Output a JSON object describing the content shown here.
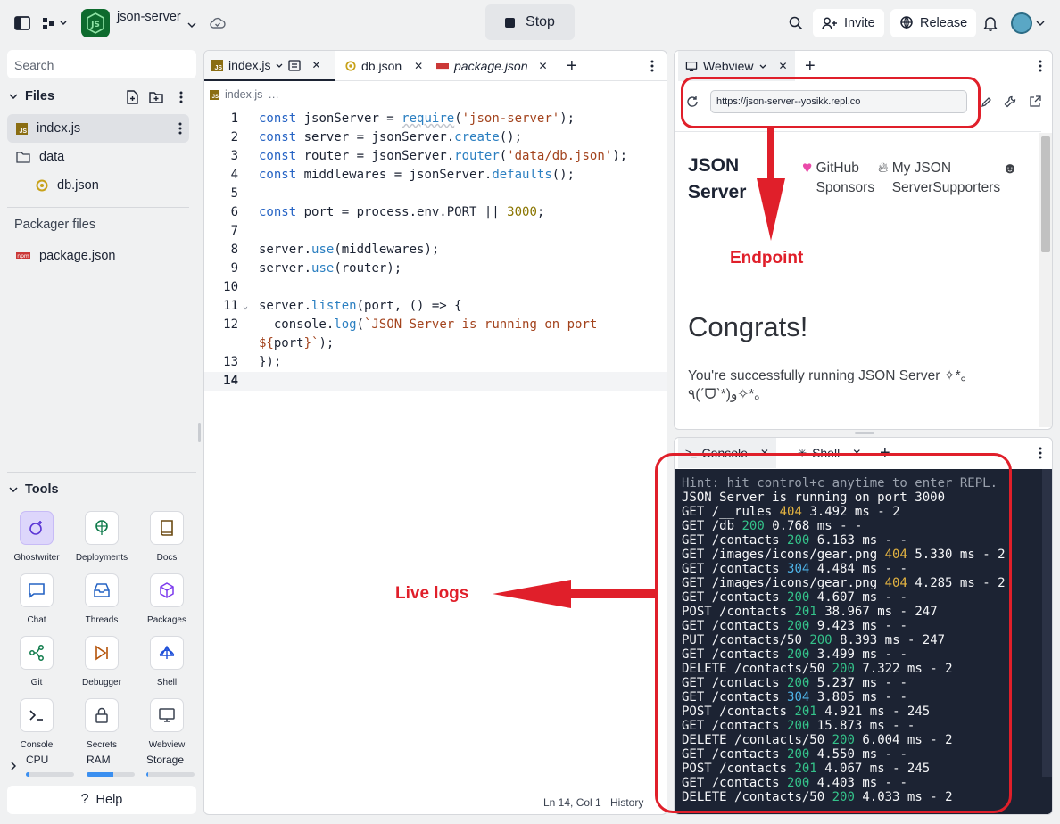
{
  "app": {
    "name": "json-server",
    "stop_label": "Stop",
    "invite_label": "Invite",
    "release_label": "Release"
  },
  "sidebar": {
    "search_placeholder": "Search",
    "files_heading": "Files",
    "files": [
      {
        "name": "index.js",
        "icon": "js-file-icon"
      },
      {
        "name": "data",
        "icon": "folder-icon"
      },
      {
        "name": "db.json",
        "icon": "json-file-icon"
      }
    ],
    "packager_heading": "Packager files",
    "packager_files": [
      {
        "name": "package.json",
        "icon": "npm-icon"
      }
    ],
    "tools_heading": "Tools",
    "tools": [
      "Ghostwriter",
      "Deployments",
      "Docs",
      "Chat",
      "Threads",
      "Packages",
      "Git",
      "Debugger",
      "Shell",
      "Console",
      "Secrets",
      "Webview"
    ],
    "resources": [
      {
        "label": "CPU",
        "fill": 0.05
      },
      {
        "label": "RAM",
        "fill": 0.55
      },
      {
        "label": "Storage",
        "fill": 0.03
      }
    ],
    "help_label": "Help"
  },
  "editor": {
    "tabs": [
      "index.js",
      "db.json",
      "package.json"
    ],
    "breadcrumb": [
      "index.js",
      "…"
    ],
    "line_numbers": [
      "1",
      "2",
      "3",
      "4",
      "5",
      "6",
      "7",
      "8",
      "9",
      "10",
      "11",
      "12",
      "13",
      "14"
    ],
    "status": {
      "position": "Ln 14, Col 1",
      "history": "History"
    }
  },
  "webview": {
    "tab_label": "Webview",
    "url": "https://json-server--yosikk.repl.co",
    "site_title": "JSON Server",
    "link_1": "GitHub Sponsors",
    "link_2": "My JSON ServerSupporters",
    "heading": "Congrats!",
    "paragraph": "You're successfully running JSON Server ✧*｡٩(ˊᗜˋ*)و✧*｡"
  },
  "console": {
    "tabs": [
      "Console",
      "Shell"
    ],
    "hint": "Hint: hit control+c anytime to enter REPL.",
    "running": "JSON Server is running on port 3000",
    "logs": [
      {
        "method": "GET",
        "path": "/__rules",
        "status": "404",
        "time": "3.492 ms",
        "size": "- 2"
      },
      {
        "method": "GET",
        "path": "/db",
        "status": "200",
        "time": "0.768 ms",
        "size": "- -"
      },
      {
        "method": "GET",
        "path": "/contacts",
        "status": "200",
        "time": "6.163 ms",
        "size": "- -"
      },
      {
        "method": "GET",
        "path": "/images/icons/gear.png",
        "status": "404",
        "time": "5.330 ms",
        "size": "- 2"
      },
      {
        "method": "GET",
        "path": "/contacts",
        "status": "304",
        "time": "4.484 ms",
        "size": "- -"
      },
      {
        "method": "GET",
        "path": "/images/icons/gear.png",
        "status": "404",
        "time": "4.285 ms",
        "size": "- 2"
      },
      {
        "method": "GET",
        "path": "/contacts",
        "status": "200",
        "time": "4.607 ms",
        "size": "- -"
      },
      {
        "method": "POST",
        "path": "/contacts",
        "status": "201",
        "time": "38.967 ms",
        "size": "- 247"
      },
      {
        "method": "GET",
        "path": "/contacts",
        "status": "200",
        "time": "9.423 ms",
        "size": "- -"
      },
      {
        "method": "PUT",
        "path": "/contacts/50",
        "status": "200",
        "time": "8.393 ms",
        "size": "- 247"
      },
      {
        "method": "GET",
        "path": "/contacts",
        "status": "200",
        "time": "3.499 ms",
        "size": "- -"
      },
      {
        "method": "DELETE",
        "path": "/contacts/50",
        "status": "200",
        "time": "7.322 ms",
        "size": "- 2"
      },
      {
        "method": "GET",
        "path": "/contacts",
        "status": "200",
        "time": "5.237 ms",
        "size": "- -"
      },
      {
        "method": "GET",
        "path": "/contacts",
        "status": "304",
        "time": "3.805 ms",
        "size": "- -"
      },
      {
        "method": "POST",
        "path": "/contacts",
        "status": "201",
        "time": "4.921 ms",
        "size": "- 245"
      },
      {
        "method": "GET",
        "path": "/contacts",
        "status": "200",
        "time": "15.873 ms",
        "size": "- -"
      },
      {
        "method": "DELETE",
        "path": "/contacts/50",
        "status": "200",
        "time": "6.004 ms",
        "size": "- 2"
      },
      {
        "method": "GET",
        "path": "/contacts",
        "status": "200",
        "time": "4.550 ms",
        "size": "- -"
      },
      {
        "method": "POST",
        "path": "/contacts",
        "status": "201",
        "time": "4.067 ms",
        "size": "- 245"
      },
      {
        "method": "GET",
        "path": "/contacts",
        "status": "200",
        "time": "4.403 ms",
        "size": "- -"
      },
      {
        "method": "DELETE",
        "path": "/contacts/50",
        "status": "200",
        "time": "4.033 ms",
        "size": "- 2"
      }
    ]
  },
  "annotations": {
    "endpoint": "Endpoint",
    "live_logs": "Live logs"
  },
  "colors": {
    "annotation_red": "#e01f2a",
    "console_bg": "#1c2333",
    "status_404": "#e3b341",
    "status_2xx": "#34c28a",
    "status_304": "#4fb4e8"
  }
}
